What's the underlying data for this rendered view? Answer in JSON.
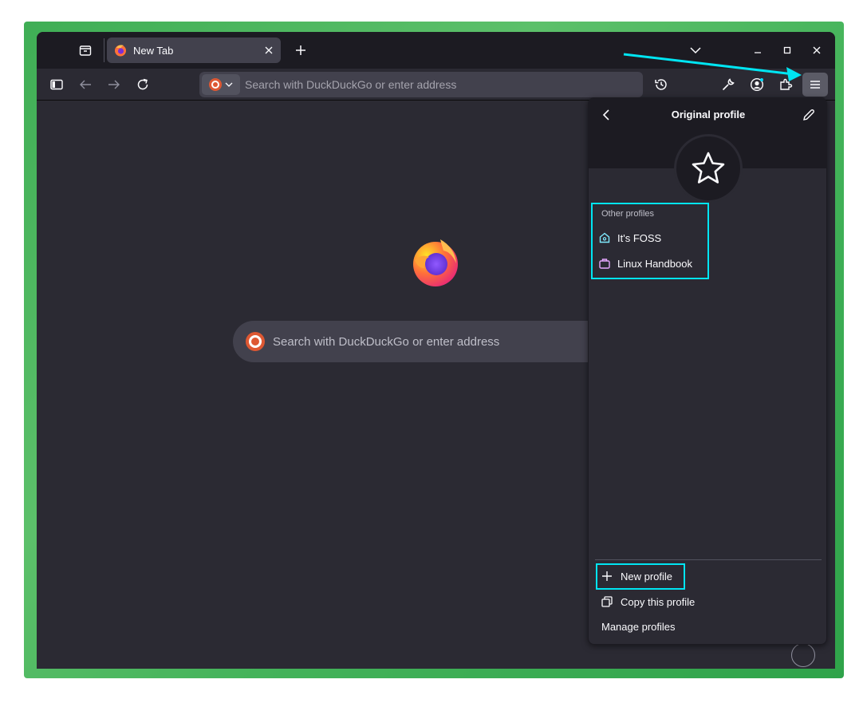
{
  "tabbar": {
    "tab_title": "New Tab"
  },
  "urlbar": {
    "placeholder": "Search with DuckDuckGo or enter address"
  },
  "content": {
    "search_placeholder": "Search with DuckDuckGo or enter address"
  },
  "profile_panel": {
    "title": "Original profile",
    "other_profiles_label": "Other profiles",
    "profiles": [
      {
        "label": "It's FOSS",
        "icon": "home-icon",
        "color": "#80ebff"
      },
      {
        "label": "Linux Handbook",
        "icon": "briefcase-icon",
        "color": "#e7a7ff"
      }
    ],
    "new_profile_label": "New profile",
    "copy_profile_label": "Copy this profile",
    "manage_profiles_label": "Manage profiles"
  },
  "annotation_color": "#00e5f2"
}
